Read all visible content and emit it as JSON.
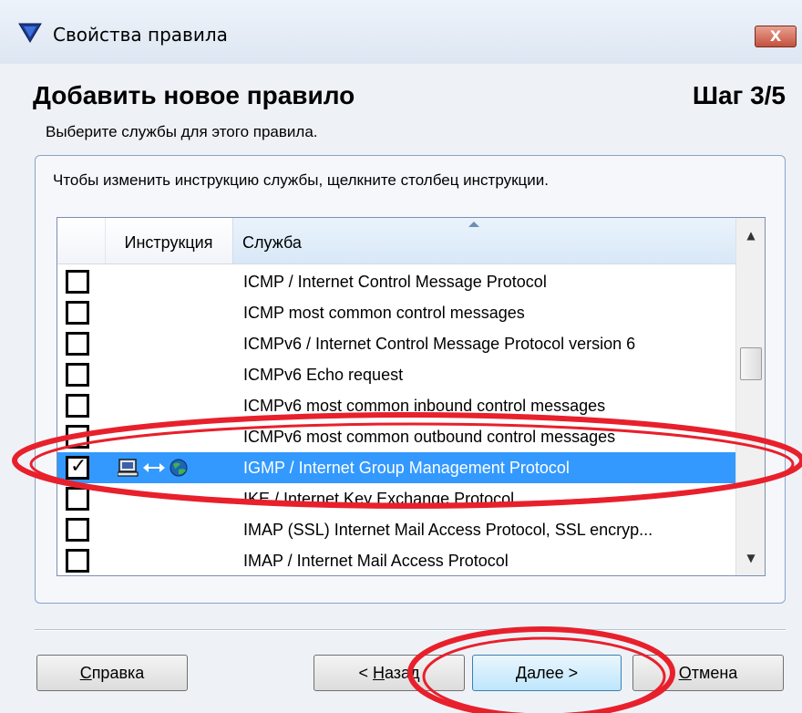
{
  "window": {
    "title": "Свойства правила",
    "close_label": "X"
  },
  "header": {
    "title": "Добавить новое правило",
    "step": "Шаг 3/5",
    "subtitle": "Выберите службы для этого правила."
  },
  "panel": {
    "instruction": "Чтобы изменить инструкцию службы, щелкните столбец инструкции."
  },
  "list": {
    "columns": {
      "instruction": "Инструкция",
      "service": "Служба"
    },
    "rows": [
      {
        "checked": false,
        "service": "ICMP / Internet Control Message Protocol"
      },
      {
        "checked": false,
        "service": "ICMP most common control messages"
      },
      {
        "checked": false,
        "service": "ICMPv6 / Internet Control Message Protocol version 6"
      },
      {
        "checked": false,
        "service": "ICMPv6 Echo request"
      },
      {
        "checked": false,
        "service": "ICMPv6 most common inbound control messages"
      },
      {
        "checked": false,
        "service": "ICMPv6 most common outbound control messages"
      },
      {
        "checked": true,
        "service": "IGMP / Internet Group Management Protocol",
        "selected": true,
        "instruction_icons": [
          "computer-icon",
          "bidirectional-arrow-icon",
          "globe-icon"
        ]
      },
      {
        "checked": false,
        "service": "IKE / Internet Key Exchange Protocol"
      },
      {
        "checked": false,
        "service": "IMAP (SSL) Internet Mail Access Protocol, SSL encryp..."
      },
      {
        "checked": false,
        "service": "IMAP / Internet Mail Access Protocol"
      }
    ]
  },
  "buttons": {
    "help": {
      "mnemonic": "С",
      "rest": "правка"
    },
    "back": {
      "prefix": "< ",
      "mnemonic": "Н",
      "rest": "азад"
    },
    "next": {
      "mnemonic": "Д",
      "rest": "алее >"
    },
    "cancel": {
      "mnemonic": "О",
      "rest": "тмена"
    }
  },
  "colors": {
    "selection": "#3399ff",
    "annotation": "#e8202c",
    "window_bg": "#eef2f7"
  }
}
